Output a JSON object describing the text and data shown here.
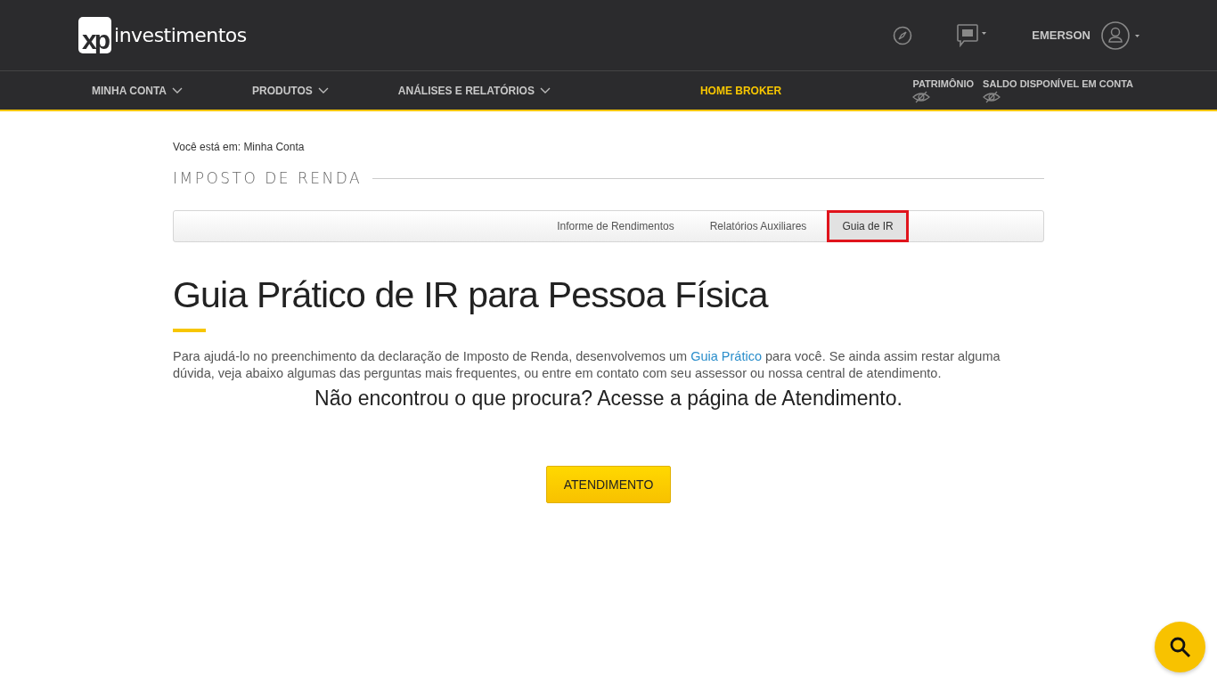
{
  "header": {
    "logo": {
      "mark": "xp",
      "word": "investimentos"
    },
    "user": "EMERSON"
  },
  "nav": [
    {
      "label": "MINHA CONTA",
      "kind": "menu"
    },
    {
      "label": "PRODUTOS",
      "kind": "menu"
    },
    {
      "label": "ANÁLISES E RELATÓRIOS",
      "kind": "menu"
    },
    {
      "label": "HOME BROKER",
      "kind": "highlight"
    }
  ],
  "balances": [
    {
      "label": "PATRIMÔNIO"
    },
    {
      "label": "SALDO DISPONÍVEL EM CONTA"
    }
  ],
  "breadcrumb": "Você está em: Minha Conta",
  "section_title": "IMPOSTO DE RENDA",
  "tabs": [
    {
      "label": "Informe de Rendimentos",
      "selected": false
    },
    {
      "label": "Relatórios Auxiliares",
      "selected": false
    },
    {
      "label": "Guia de IR",
      "selected": true
    }
  ],
  "heading": "Guia Prático de IR para Pessoa Física",
  "intro": {
    "before": "Para ajudá-lo no preenchimento da declaração de Imposto de Renda, desenvolvemos um ",
    "link": "Guia Prático",
    "after": " para você. Se ainda assim restar alguma dúvida, veja abaixo algumas das perguntas mais frequentes, ou entre em contato com seu assessor ou nossa central de atendimento."
  },
  "cta_text": "Não encontrou o que procura? Acesse a página de Atendimento.",
  "cta_button": "ATENDIMENTO"
}
